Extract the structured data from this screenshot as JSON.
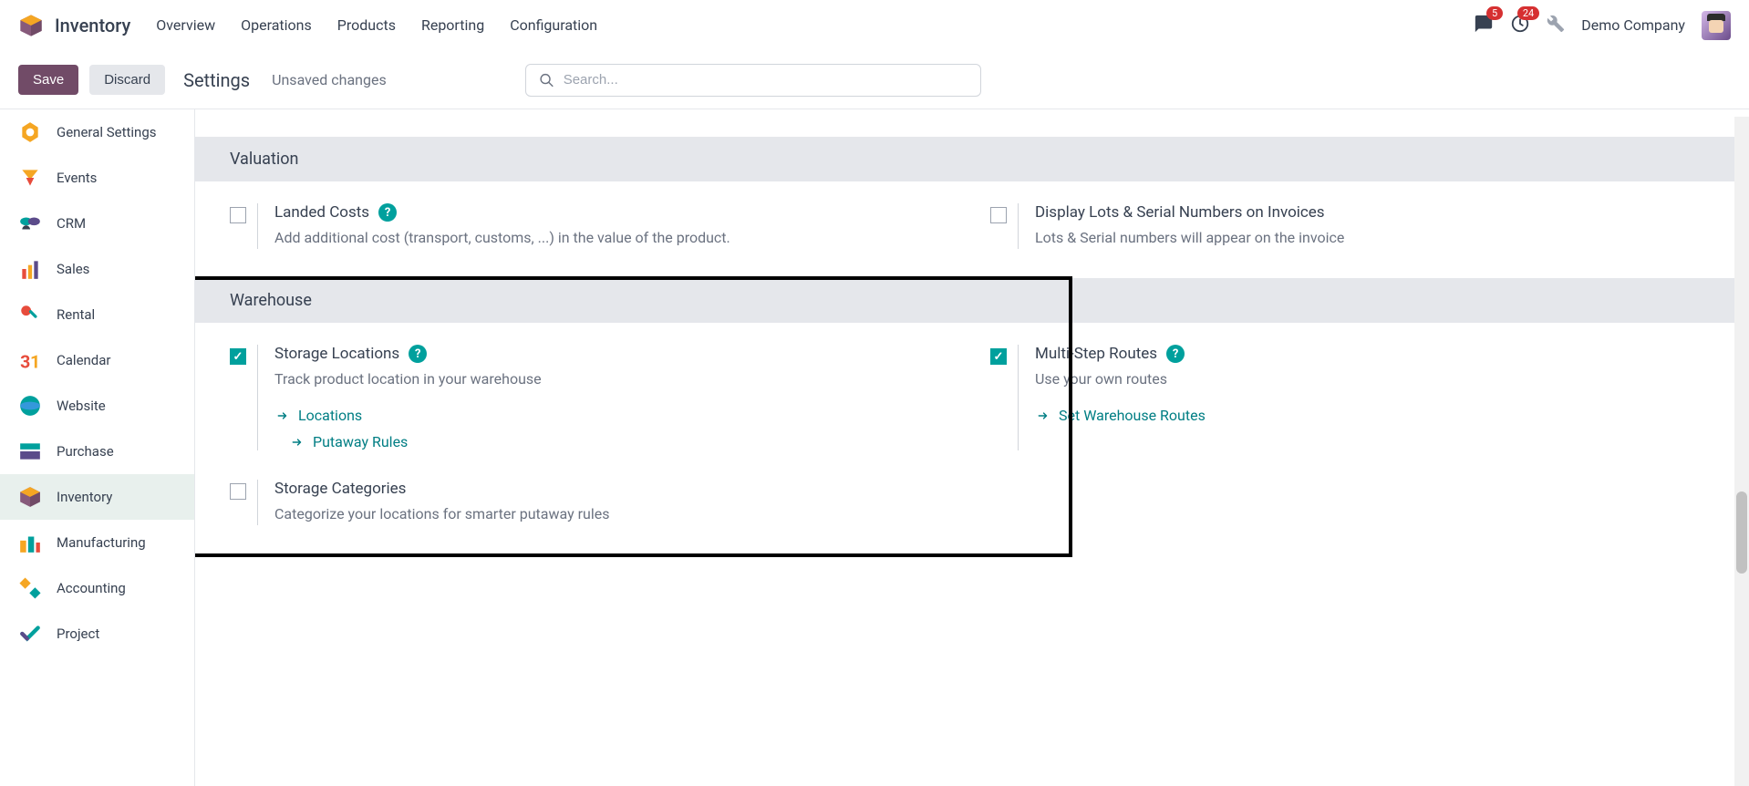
{
  "app": {
    "title": "Inventory"
  },
  "nav": {
    "items": [
      "Overview",
      "Operations",
      "Products",
      "Reporting",
      "Configuration"
    ]
  },
  "header": {
    "company": "Demo Company",
    "messages_badge": "5",
    "activities_badge": "24"
  },
  "actionbar": {
    "save": "Save",
    "discard": "Discard",
    "breadcrumb": "Settings",
    "status": "Unsaved changes",
    "search_placeholder": "Search..."
  },
  "sidebar": {
    "items": [
      {
        "label": "General Settings",
        "icon": "gear"
      },
      {
        "label": "Events",
        "icon": "events"
      },
      {
        "label": "CRM",
        "icon": "crm"
      },
      {
        "label": "Sales",
        "icon": "sales"
      },
      {
        "label": "Rental",
        "icon": "rental"
      },
      {
        "label": "Calendar",
        "icon": "calendar"
      },
      {
        "label": "Website",
        "icon": "website"
      },
      {
        "label": "Purchase",
        "icon": "purchase"
      },
      {
        "label": "Inventory",
        "icon": "inventory"
      },
      {
        "label": "Manufacturing",
        "icon": "manufacturing"
      },
      {
        "label": "Accounting",
        "icon": "accounting"
      },
      {
        "label": "Project",
        "icon": "project"
      }
    ],
    "active_index": 8
  },
  "sections": [
    {
      "title": "Valuation",
      "settings": [
        {
          "checked": false,
          "title": "Landed Costs",
          "help": true,
          "desc": "Add additional cost (transport, customs, ...) in the value of the product.",
          "links": []
        },
        {
          "checked": false,
          "title": "Display Lots & Serial Numbers on Invoices",
          "help": false,
          "desc": "Lots & Serial numbers will appear on the invoice",
          "links": []
        }
      ]
    },
    {
      "title": "Warehouse",
      "highlighted": true,
      "settings": [
        {
          "checked": true,
          "title": "Storage Locations",
          "help": true,
          "desc": "Track product location in your warehouse",
          "links": [
            {
              "label": "Locations",
              "indent": false
            },
            {
              "label": "Putaway Rules",
              "indent": true
            }
          ]
        },
        {
          "checked": true,
          "title": "Multi-Step Routes",
          "help": true,
          "desc": "Use your own routes",
          "links": [
            {
              "label": "Set Warehouse Routes",
              "indent": false
            }
          ]
        }
      ],
      "settings_row2": [
        {
          "checked": false,
          "title": "Storage Categories",
          "help": false,
          "desc": "Categorize your locations for smarter putaway rules",
          "links": []
        }
      ]
    }
  ]
}
